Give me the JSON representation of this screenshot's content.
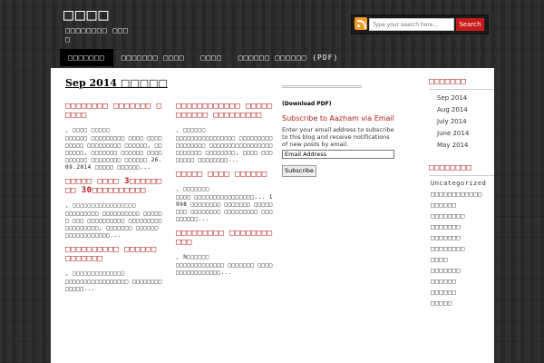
{
  "header": {
    "site_title": "□□□□",
    "site_desc": "□□□□□□□□ □□□□",
    "search_placeholder": "Type your search here...",
    "search_button": "Search"
  },
  "nav": {
    "items": [
      {
        "label": "□□□□□□□"
      },
      {
        "label": "□□□□□□□ □□□□"
      },
      {
        "label": "□□□□"
      },
      {
        "label": "□□□□□□ □□□□□□ (PDF)"
      }
    ]
  },
  "main": {
    "archive_title": "Sep 2014 □□□□□",
    "col1": [
      {
        "title": "□□□□□□□□ □□□□□□□ □□□□□",
        "meta": ", □□□□ □□□□□",
        "text": "□□□□□□ □□□□□□□□□ □□□□ □□□□□□□□□ □□□□□□□□□ □□□□□□, □□□□□□□, □□□□□□□ □□□□□□ □□□□□□□□□□ □□□□□□□□ □□□□□□ 26.09.2014 □□□□□ □□□□□□..."
      },
      {
        "title": "□□□□□ □□□□ 3□□□□□□□□ 30□□□□□□□□□□",
        "meta": ", □□□□□□□□□□□□□□□□□",
        "text": "□□□□□□□□□ □□□□□□□□□□ □□□□□□ □□□ □□□□□□□□□□ □□□□□□□□□ □□□□□□□□□, □□□□□□□ □□□□□□ □□□□□□□□□□□□..."
      },
      {
        "title": "□□□□□□□□□□ □□□□□□ □□□□□□□",
        "meta": ", □□□□□□□□□□□□□□",
        "text": "□□□□□□□□□□□□□□□□□ □□□□□□□□□□□□□..."
      }
    ],
    "col2": [
      {
        "title": "□□□□□□□□□□□□ □□□□□□□□□□□ □□□□□□□□□",
        "meta": ", □□□□□□",
        "text": "□□□□□□□□□□□□□□□□ □□□□□□□□□ □□□□□□□□ □□□□□□□□□□□□□□□□□ □□□□□□□ □□□□□□□□, □□□□ □□□□□□□□ □□□□□□□□..."
      },
      {
        "title": "□□□□□ □□□□ □□□□□□",
        "meta": ", □□□□□□□",
        "text": "□□□□ □□□□□□□□□□□□□□□□... 1998 □□□□□□□□ □□□□□□□ □□□□□□□□ □□□□□□□□ □□□□□□□□□ □□□□□□□□□..."
      },
      {
        "title": "□□□□□□□□□ □□□□□□□□□□□",
        "meta": ", N□□□□□□",
        "text": "□□□□□□□□□□□□□ □□□□□□□ □□□□□□□□□□□□□□□□..."
      }
    ]
  },
  "sidebar_mid": {
    "download": "(Download PDF)",
    "subscribe_title": "Subscribe to Aazham via Email",
    "subscribe_text": "Enter your email address to subscribe to this blog and receive notifications of new posts by email.",
    "email_value": "Email Address",
    "subscribe_button": "Subscribe"
  },
  "sidebar_right": {
    "archives_title": "□□□□□□□",
    "archives": [
      "Sep 2014",
      "Aug 2014",
      "July 2014",
      "June 2014",
      "May 2014"
    ],
    "categories_title": "□□□□□□□□",
    "categories": [
      "Uncategorized",
      "□□□□□□□□□□□□",
      "□□□□□□",
      "□□□□□□□□",
      "□□□□□□□",
      "□□□□□□□",
      "□□□□□□□□",
      "□□□□",
      "□□□□□□□",
      "□□□□□□",
      "□□□□□□",
      "□□□□□"
    ]
  }
}
